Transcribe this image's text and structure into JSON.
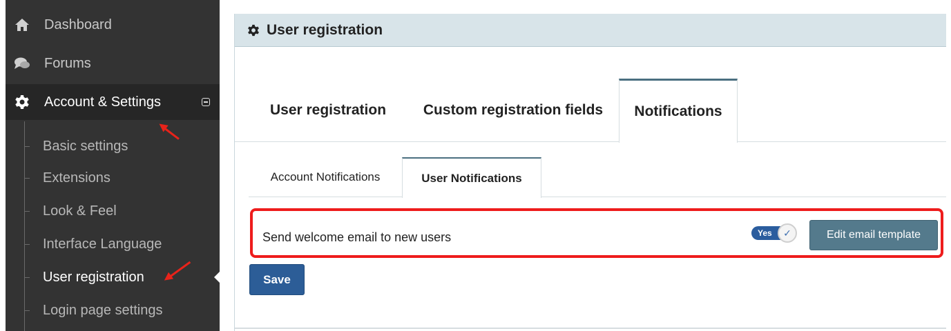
{
  "sidebar": {
    "nav": [
      {
        "label": "Dashboard",
        "icon": "home-icon"
      },
      {
        "label": "Forums",
        "icon": "chat-bubbles-icon"
      },
      {
        "label": "Account & Settings",
        "icon": "gear-icon"
      }
    ],
    "sub_items": [
      {
        "label": "Basic settings"
      },
      {
        "label": "Extensions"
      },
      {
        "label": "Look & Feel"
      },
      {
        "label": "Interface Language"
      },
      {
        "label": "User registration"
      },
      {
        "label": "Login page settings"
      }
    ]
  },
  "panel": {
    "title": "User registration",
    "tabs": [
      "User registration",
      "Custom registration fields",
      "Notifications"
    ],
    "sub_tabs": [
      "Account Notifications",
      "User Notifications"
    ],
    "setting": {
      "label": "Send welcome email to new users",
      "toggle_label": "Yes",
      "edit_button": "Edit email template"
    },
    "save_button": "Save"
  },
  "colors": {
    "sidebar_bg": "#333333",
    "header_bg": "#d8e4e9",
    "primary_button": "#2c5d97",
    "secondary_button": "#547a8c",
    "highlight": "#ee1c1c"
  }
}
